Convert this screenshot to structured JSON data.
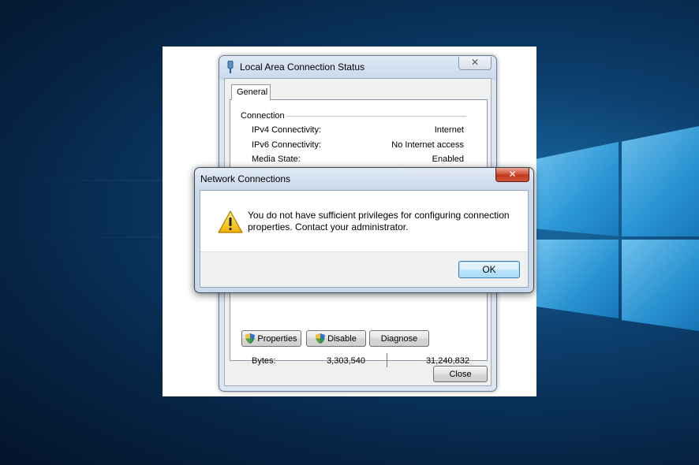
{
  "status_dialog": {
    "title": "Local Area Connection Status",
    "close_glyph": "✕",
    "tab": "General",
    "group_label": "Connection",
    "rows": [
      {
        "label": "IPv4 Connectivity:",
        "value": "Internet"
      },
      {
        "label": "IPv6 Connectivity:",
        "value": "No Internet access"
      },
      {
        "label": "Media State:",
        "value": "Enabled"
      }
    ],
    "bytes": {
      "label": "Bytes:",
      "sent": "3,303,540",
      "received": "31,240,832"
    },
    "buttons": {
      "properties": "Properties",
      "disable": "Disable",
      "diagnose": "Diagnose",
      "close": "Close"
    }
  },
  "error_dialog": {
    "title": "Network Connections",
    "close_glyph": "✕",
    "message": "You do not have sufficient privileges for configuring connection properties. Contact your administrator.",
    "ok_label": "OK"
  },
  "colors": {
    "desktop_accent": "#1a6fa8",
    "close_red": "#c3361d",
    "ok_blue": "#3c7fb1"
  },
  "icons": {
    "window_icon": "network-connection-icon",
    "warning": "warning-icon",
    "uac_shield": "uac-shield-icon"
  }
}
